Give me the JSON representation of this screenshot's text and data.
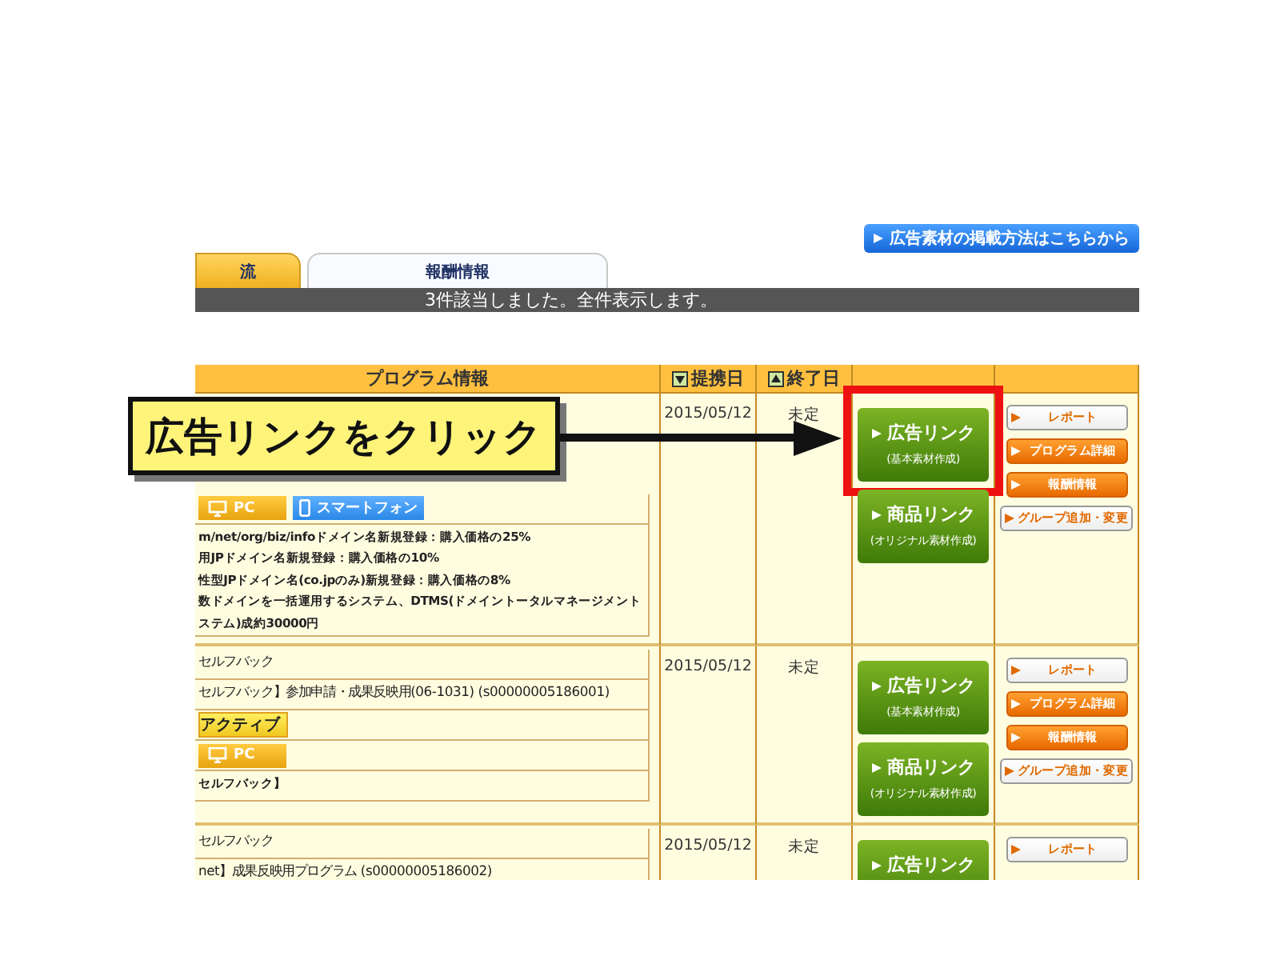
{
  "header_link": "広告素材の掲載方法はこちらから",
  "tabs": [
    {
      "label": "流",
      "selected": true
    },
    {
      "label": "報酬情報",
      "selected": false
    }
  ],
  "status_bar": "3件該当しました。全件表示します。",
  "table": {
    "columns": [
      {
        "label": "プログラム情報"
      },
      {
        "label": "提携日",
        "ascending": false
      },
      {
        "label": "終了日",
        "ascending": true
      }
    ],
    "rows": [
      {
        "program": [
          {
            "kind": "tags",
            "tags": [
              {
                "label": "PC",
                "kind": "pc"
              },
              {
                "label": "スマートフォン",
                "kind": "phone"
              }
            ]
          },
          {
            "kind": "text",
            "lines": [
              "m/net/org/biz/infoドメイン名新規登録：購入価格の25%",
              "用JPドメイン名新規登録：購入価格の10%",
              "性型JPドメイン名(co.jpのみ)新規登録：購入価格の8%",
              "数ドメインを一括運用するシステム、DTMS(ドメイントータルマネージメント",
              "ステム)成約30000円"
            ],
            "bold": true
          }
        ],
        "date": "2015/05/12",
        "end": "未定",
        "links": [
          {
            "title": "広告リンク",
            "sub": "(基本素材作成)",
            "highlighted": true
          },
          {
            "title": "商品リンク",
            "sub": "(オリジナル素材作成)",
            "highlighted": false
          }
        ],
        "actions": [
          {
            "label": "レポート",
            "kind": "plain"
          },
          {
            "label": "プログラム詳細",
            "kind": "orange"
          },
          {
            "label": "報酬情報",
            "kind": "orange"
          },
          {
            "label": "グループ追加・変更",
            "kind": "plain"
          }
        ]
      },
      {
        "program": [
          {
            "kind": "text",
            "lines": [
              "セルフバック"
            ],
            "bold": false
          },
          {
            "kind": "text",
            "lines": [
              "セルフバック】参加申請・成果反映用(06-1031) (s00000005186001)"
            ],
            "bold": false
          },
          {
            "kind": "badge",
            "label": "アクティブ"
          },
          {
            "kind": "tags",
            "tags": [
              {
                "label": "PC",
                "kind": "pc"
              }
            ]
          },
          {
            "kind": "text",
            "lines": [
              "セルフバック】"
            ],
            "bold": true
          }
        ],
        "date": "2015/05/12",
        "end": "未定",
        "links": [
          {
            "title": "広告リンク",
            "sub": "(基本素材作成)",
            "highlighted": false
          },
          {
            "title": "商品リンク",
            "sub": "(オリジナル素材作成)",
            "highlighted": false
          }
        ],
        "actions": [
          {
            "label": "レポート",
            "kind": "plain"
          },
          {
            "label": "プログラム詳細",
            "kind": "orange"
          },
          {
            "label": "報酬情報",
            "kind": "orange"
          },
          {
            "label": "グループ追加・変更",
            "kind": "plain"
          }
        ]
      },
      {
        "program": [
          {
            "kind": "text",
            "lines": [
              "セルフバック"
            ],
            "bold": false
          },
          {
            "kind": "text",
            "lines": [
              "net】成果反映用プログラム (s00000005186002)"
            ],
            "bold": false
          }
        ],
        "date": "2015/05/12",
        "end": "未定",
        "links": [
          {
            "title": "広告リンク",
            "highlighted": false
          }
        ],
        "actions": [
          {
            "label": "レポート",
            "kind": "plain"
          }
        ]
      }
    ]
  },
  "callout": {
    "text": "広告リンクをクリック"
  }
}
